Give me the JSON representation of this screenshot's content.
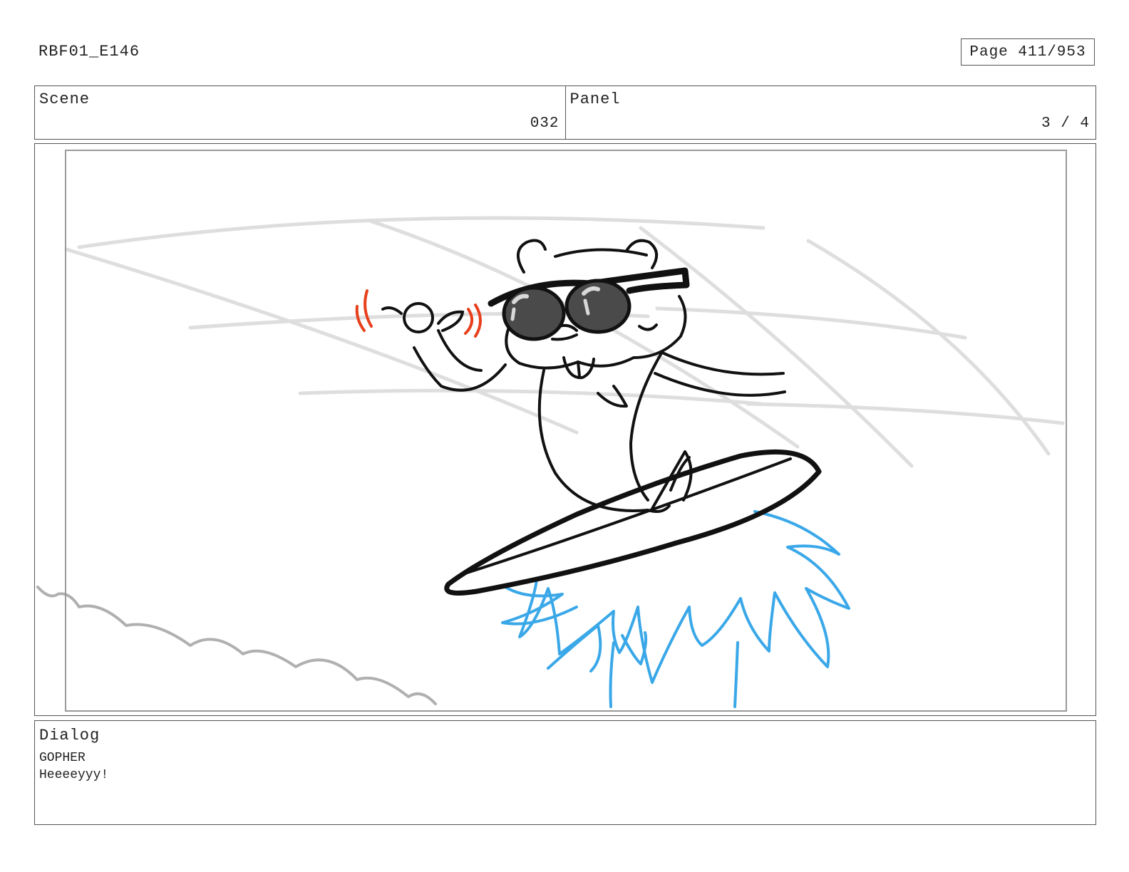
{
  "header": {
    "doc_id": "RBF01_E146",
    "page_label": "Page 411/953"
  },
  "scene": {
    "label": "Scene",
    "value": "032"
  },
  "panel": {
    "label": "Panel",
    "value": "3 / 4"
  },
  "dialog": {
    "label": "Dialog",
    "speaker": "GOPHER",
    "line": "Heeeeyyy!"
  },
  "colors": {
    "ink": "#111111",
    "sketch": "#dcdcdc",
    "splash": "#3aa8e8",
    "accent": "#e8401c",
    "lens": "#4a4a4a"
  }
}
